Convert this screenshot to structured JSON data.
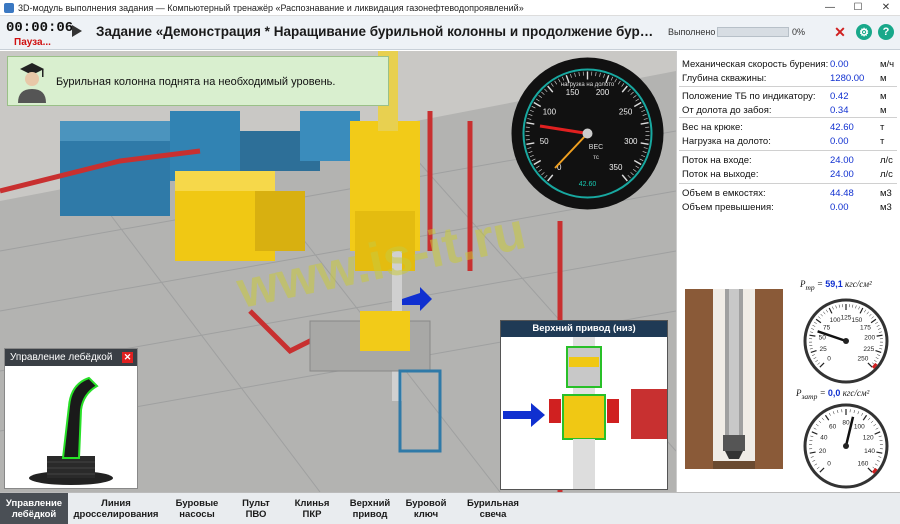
{
  "window": {
    "title": "3D-модуль выполнения задания — Компьютерный тренажёр «Распознавание и ликвидация газонефтеводопроявлений»"
  },
  "header": {
    "timer": "00:00:06",
    "status": "Пауза...",
    "task_title": "Задание «Демонстрация * Наращивание бурильной колонны и продолжение бурения...",
    "done_label": "Выполнено",
    "progress_percent": 0,
    "progress_text": "0%"
  },
  "message": {
    "text": "Бурильная колонна поднята на необходимый уровень."
  },
  "gauge": {
    "title": "нагрузка на долото",
    "units": "тс",
    "label": "ВЕС",
    "ticks": [
      "0",
      "50",
      "100",
      "150",
      "200",
      "250",
      "300",
      "350"
    ],
    "bottom": "42.60"
  },
  "parameters": [
    {
      "label": "Механическая скорость бурения:",
      "value": "0.00",
      "unit": "м/ч"
    },
    {
      "label": "Глубина скважины:",
      "value": "1280.00",
      "unit": "м"
    },
    {
      "label": "Положение ТБ по индикатору:",
      "value": "0.42",
      "unit": "м"
    },
    {
      "label": "От долота до забоя:",
      "value": "0.34",
      "unit": "м"
    },
    {
      "label": "Вес на крюке:",
      "value": "42.60",
      "unit": "т"
    },
    {
      "label": "Нагрузка на долото:",
      "value": "0.00",
      "unit": "т"
    },
    {
      "label": "Поток на входе:",
      "value": "24.00",
      "unit": "л/с"
    },
    {
      "label": "Поток на выходе:",
      "value": "24.00",
      "unit": "л/с"
    },
    {
      "label": "Объем в емкостях:",
      "value": "44.48",
      "unit": "м3"
    },
    {
      "label": "Объем превышения:",
      "value": "0.00",
      "unit": "м3"
    }
  ],
  "manometers": {
    "tubing": {
      "symbol": "P",
      "sub": "тр",
      "value": "59,1",
      "unit": "кгс/см²",
      "ticks": [
        "0",
        "25",
        "50",
        "75",
        "100",
        "125",
        "150",
        "175",
        "200",
        "225",
        "250"
      ]
    },
    "annulus": {
      "symbol": "P",
      "sub": "затр",
      "value": "0,0",
      "unit": "кгс/см²",
      "ticks": [
        "0",
        "20",
        "40",
        "60",
        "80",
        "100",
        "120",
        "140",
        "160"
      ]
    }
  },
  "lebedka_panel": {
    "title": "Управление лебёдкой"
  },
  "topdrive_panel": {
    "title": "Верхний привод (низ)"
  },
  "watermark": "www.is-it.ru",
  "tabs": [
    {
      "label": "Управление лебёдкой",
      "active": true
    },
    {
      "label": "Линия дросселирования",
      "active": false
    },
    {
      "label": "Буровые насосы",
      "active": false
    },
    {
      "label": "Пульт ПВО",
      "active": false
    },
    {
      "label": "Клинья ПКР",
      "active": false
    },
    {
      "label": "Верхний привод",
      "active": false
    },
    {
      "label": "Буровой ключ",
      "active": false
    },
    {
      "label": "Бурильная свеча",
      "active": false
    }
  ],
  "colors": {
    "accent": "#3a78c2",
    "value": "#1030d0",
    "alert": "#d01010",
    "teal": "#18a88a"
  }
}
